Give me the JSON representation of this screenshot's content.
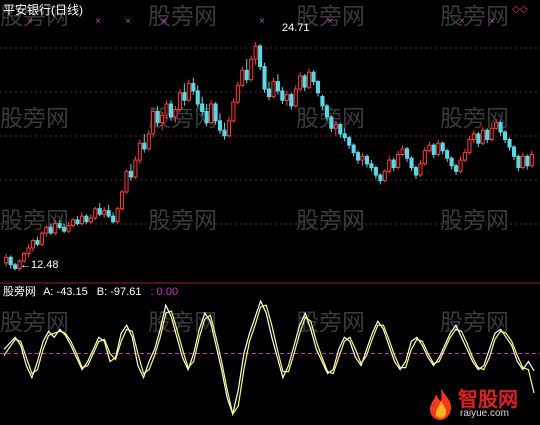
{
  "title": "平安银行(日线)",
  "watermark": "股旁网",
  "colors": {
    "background": "#000000",
    "up": "#ff3a3a",
    "down": "#5ad8e6",
    "divider": "#9b1f1f",
    "grid": "#7a1f1f",
    "marker": "#c838c8",
    "lineA": "#ffffff",
    "lineB": "#ffff66",
    "zeroLine": "#b040b0",
    "title": "#ffffff",
    "valueA": "#ffffff",
    "valueB": "#ffffff",
    "valueC": "#c838c8"
  },
  "price_panel": {
    "high_label": "24.71",
    "low_label": "12.48",
    "corner_glyph": "◇◇",
    "arrow_icon": "left-arrow-icon"
  },
  "indicator_panel": {
    "name": "股旁网",
    "a_label": "A:",
    "a_value": "-43.15",
    "b_label": "B:",
    "b_value": "-97.61",
    "c_label": ":",
    "c_value": "0.00"
  },
  "logo": {
    "main": "智股网",
    "sub": "raiyue.com",
    "icon": "flame-icon"
  },
  "chart_data": [
    {
      "type": "candlestick",
      "title": "平安银行(日线)",
      "annotations": [
        "24.71",
        "12.48"
      ],
      "ylim": [
        12.2,
        26.0
      ],
      "grid": true,
      "candles": [
        [
          12.9,
          13.4,
          12.7,
          13.2
        ],
        [
          13.2,
          13.3,
          12.6,
          12.8
        ],
        [
          12.8,
          12.9,
          12.5,
          12.6
        ],
        [
          12.6,
          13.1,
          12.48,
          13.0
        ],
        [
          13.0,
          13.5,
          12.9,
          13.4
        ],
        [
          13.4,
          13.9,
          13.2,
          13.7
        ],
        [
          13.7,
          14.2,
          13.5,
          14.1
        ],
        [
          14.1,
          14.3,
          13.8,
          13.9
        ],
        [
          13.9,
          14.6,
          13.8,
          14.5
        ],
        [
          14.5,
          14.9,
          14.3,
          14.8
        ],
        [
          14.8,
          15.0,
          14.4,
          14.5
        ],
        [
          14.5,
          15.2,
          14.4,
          15.0
        ],
        [
          15.0,
          15.2,
          14.7,
          14.8
        ],
        [
          14.8,
          15.0,
          14.5,
          14.6
        ],
        [
          14.6,
          15.1,
          14.5,
          14.9
        ],
        [
          14.9,
          15.3,
          14.8,
          15.2
        ],
        [
          15.2,
          15.4,
          14.9,
          15.0
        ],
        [
          15.0,
          15.6,
          14.9,
          15.4
        ],
        [
          15.4,
          15.5,
          15.0,
          15.1
        ],
        [
          15.1,
          15.5,
          15.0,
          15.3
        ],
        [
          15.3,
          15.9,
          15.2,
          15.8
        ],
        [
          15.8,
          16.1,
          15.4,
          15.5
        ],
        [
          15.5,
          15.9,
          15.3,
          15.7
        ],
        [
          15.7,
          16.0,
          15.3,
          15.4
        ],
        [
          15.4,
          15.6,
          15.0,
          15.1
        ],
        [
          15.1,
          15.9,
          15.0,
          15.8
        ],
        [
          15.8,
          16.8,
          15.7,
          16.7
        ],
        [
          16.7,
          17.9,
          16.6,
          17.8
        ],
        [
          17.8,
          18.2,
          17.3,
          17.5
        ],
        [
          17.5,
          18.6,
          17.4,
          18.4
        ],
        [
          18.4,
          19.5,
          18.2,
          19.3
        ],
        [
          19.3,
          19.8,
          18.8,
          19.0
        ],
        [
          19.0,
          20.0,
          18.9,
          19.8
        ],
        [
          19.8,
          21.2,
          19.6,
          21.0
        ],
        [
          21.0,
          21.3,
          20.2,
          20.4
        ],
        [
          20.4,
          21.0,
          20.0,
          20.8
        ],
        [
          20.8,
          21.6,
          20.6,
          21.4
        ],
        [
          21.4,
          21.6,
          20.5,
          20.7
        ],
        [
          20.7,
          21.3,
          20.4,
          21.1
        ],
        [
          21.1,
          22.2,
          21.0,
          22.0
        ],
        [
          22.0,
          22.5,
          21.3,
          21.6
        ],
        [
          21.6,
          22.7,
          21.5,
          22.5
        ],
        [
          22.5,
          22.8,
          21.9,
          22.1
        ],
        [
          22.1,
          22.4,
          21.2,
          21.4
        ],
        [
          21.4,
          21.8,
          20.8,
          21.0
        ],
        [
          21.0,
          21.4,
          20.2,
          20.4
        ],
        [
          20.4,
          21.6,
          20.3,
          21.4
        ],
        [
          21.4,
          21.5,
          20.3,
          20.5
        ],
        [
          20.5,
          20.9,
          19.8,
          20.0
        ],
        [
          20.0,
          20.4,
          19.5,
          19.7
        ],
        [
          19.7,
          20.7,
          19.6,
          20.5
        ],
        [
          20.5,
          21.7,
          20.4,
          21.5
        ],
        [
          21.5,
          22.6,
          21.4,
          22.4
        ],
        [
          22.4,
          23.4,
          22.3,
          23.2
        ],
        [
          23.2,
          23.8,
          22.5,
          22.7
        ],
        [
          22.7,
          24.0,
          22.6,
          23.8
        ],
        [
          23.8,
          24.71,
          23.5,
          24.5
        ],
        [
          24.5,
          24.6,
          23.2,
          23.4
        ],
        [
          23.4,
          23.6,
          22.0,
          22.2
        ],
        [
          22.2,
          22.6,
          21.6,
          21.8
        ],
        [
          21.8,
          22.8,
          21.7,
          22.6
        ],
        [
          22.6,
          23.0,
          21.9,
          22.1
        ],
        [
          22.1,
          22.3,
          21.4,
          21.6
        ],
        [
          21.6,
          22.1,
          21.3,
          21.9
        ],
        [
          21.9,
          22.0,
          21.1,
          21.3
        ],
        [
          21.3,
          22.4,
          21.2,
          22.2
        ],
        [
          22.2,
          23.1,
          22.1,
          22.9
        ],
        [
          22.9,
          23.0,
          22.1,
          22.3
        ],
        [
          22.3,
          23.3,
          22.2,
          23.1
        ],
        [
          23.1,
          23.2,
          22.4,
          22.6
        ],
        [
          22.6,
          22.7,
          21.8,
          22.0
        ],
        [
          21.8,
          21.9,
          21.1,
          21.3
        ],
        [
          21.3,
          21.4,
          20.5,
          20.7
        ],
        [
          20.7,
          20.8,
          19.9,
          20.1
        ],
        [
          20.1,
          20.5,
          19.7,
          20.3
        ],
        [
          20.3,
          20.4,
          19.6,
          19.8
        ],
        [
          19.8,
          20.1,
          19.4,
          19.6
        ],
        [
          19.6,
          19.7,
          19.0,
          19.2
        ],
        [
          19.2,
          19.3,
          18.6,
          18.8
        ],
        [
          18.8,
          18.9,
          18.2,
          18.4
        ],
        [
          18.4,
          18.8,
          18.1,
          18.6
        ],
        [
          18.6,
          18.7,
          18.0,
          18.2
        ],
        [
          18.2,
          18.4,
          17.8,
          18.0
        ],
        [
          18.0,
          18.1,
          17.4,
          17.6
        ],
        [
          17.6,
          17.7,
          17.1,
          17.3
        ],
        [
          17.3,
          17.9,
          17.2,
          17.8
        ],
        [
          17.8,
          18.6,
          17.7,
          18.4
        ],
        [
          18.4,
          18.5,
          17.8,
          18.0
        ],
        [
          18.0,
          18.9,
          17.9,
          18.7
        ],
        [
          18.7,
          19.2,
          18.6,
          19.0
        ],
        [
          19.0,
          19.1,
          18.3,
          18.5
        ],
        [
          18.5,
          18.6,
          17.8,
          18.0
        ],
        [
          18.0,
          18.1,
          17.4,
          17.6
        ],
        [
          17.6,
          18.4,
          17.5,
          18.2
        ],
        [
          18.2,
          19.1,
          18.1,
          18.9
        ],
        [
          18.9,
          19.4,
          18.8,
          19.2
        ],
        [
          19.2,
          19.3,
          18.5,
          18.7
        ],
        [
          18.7,
          19.5,
          18.6,
          19.3
        ],
        [
          19.3,
          19.4,
          18.7,
          18.9
        ],
        [
          18.9,
          19.0,
          18.3,
          18.5
        ],
        [
          18.5,
          18.6,
          17.9,
          18.1
        ],
        [
          18.1,
          18.2,
          17.6,
          17.8
        ],
        [
          17.8,
          18.6,
          17.7,
          18.4
        ],
        [
          18.4,
          19.0,
          18.3,
          18.8
        ],
        [
          18.8,
          19.7,
          18.7,
          19.5
        ],
        [
          19.5,
          20.0,
          19.3,
          19.8
        ],
        [
          19.8,
          19.9,
          19.1,
          19.3
        ],
        [
          19.3,
          20.2,
          19.2,
          20.0
        ],
        [
          20.0,
          20.1,
          19.3,
          19.5
        ],
        [
          19.5,
          20.3,
          19.4,
          20.1
        ],
        [
          20.1,
          20.6,
          20.0,
          20.4
        ],
        [
          20.4,
          20.5,
          19.7,
          19.9
        ],
        [
          19.9,
          20.0,
          19.3,
          19.5
        ],
        [
          19.5,
          19.6,
          18.9,
          19.1
        ],
        [
          19.1,
          19.2,
          18.4,
          18.6
        ],
        [
          18.6,
          18.7,
          17.8,
          18.0
        ],
        [
          18.0,
          18.8,
          17.9,
          18.6
        ],
        [
          18.6,
          18.7,
          17.9,
          18.1
        ],
        [
          18.1,
          18.9,
          18.0,
          18.7
        ]
      ]
    },
    {
      "type": "line",
      "title": "股旁网",
      "series": [
        {
          "name": "A",
          "last": -43.15,
          "values": [
            10,
            25,
            40,
            20,
            -30,
            -60,
            -20,
            30,
            55,
            40,
            60,
            45,
            20,
            -10,
            -40,
            -20,
            10,
            40,
            30,
            -20,
            -10,
            50,
            70,
            40,
            -30,
            -60,
            -20,
            10,
            60,
            120,
            90,
            40,
            -10,
            -40,
            0,
            60,
            100,
            80,
            20,
            -40,
            -110,
            -150,
            -90,
            0,
            50,
            90,
            130,
            100,
            40,
            -10,
            -60,
            -30,
            20,
            70,
            100,
            60,
            10,
            -20,
            -50,
            -40,
            10,
            40,
            30,
            -10,
            -30,
            10,
            50,
            80,
            60,
            20,
            -20,
            -40,
            -20,
            30,
            40,
            20,
            -10,
            -30,
            -10,
            20,
            50,
            70,
            40,
            10,
            -20,
            -40,
            -30,
            10,
            50,
            60,
            40,
            20,
            -20,
            -40,
            -20,
            -43
          ]
        },
        {
          "name": "B",
          "last": -97.61,
          "values": [
            -5,
            15,
            35,
            30,
            -10,
            -50,
            -40,
            10,
            45,
            50,
            55,
            50,
            30,
            0,
            -35,
            -30,
            0,
            30,
            35,
            0,
            -15,
            30,
            60,
            55,
            0,
            -50,
            -40,
            -5,
            40,
            100,
            105,
            60,
            10,
            -35,
            -20,
            40,
            85,
            95,
            40,
            -20,
            -90,
            -150,
            -130,
            -40,
            30,
            70,
            115,
            120,
            70,
            10,
            -45,
            -45,
            0,
            50,
            90,
            80,
            30,
            -10,
            -45,
            -50,
            -10,
            30,
            40,
            10,
            -25,
            -5,
            35,
            70,
            70,
            35,
            -5,
            -35,
            -35,
            10,
            35,
            30,
            0,
            -25,
            -20,
            10,
            40,
            60,
            55,
            25,
            -10,
            -35,
            -40,
            -10,
            35,
            55,
            50,
            30,
            -5,
            -35,
            -40,
            -98
          ]
        },
        {
          "name": ":",
          "last": 0.0,
          "values": []
        }
      ],
      "ylim": [
        -160,
        140
      ],
      "reference_line": 0
    }
  ]
}
